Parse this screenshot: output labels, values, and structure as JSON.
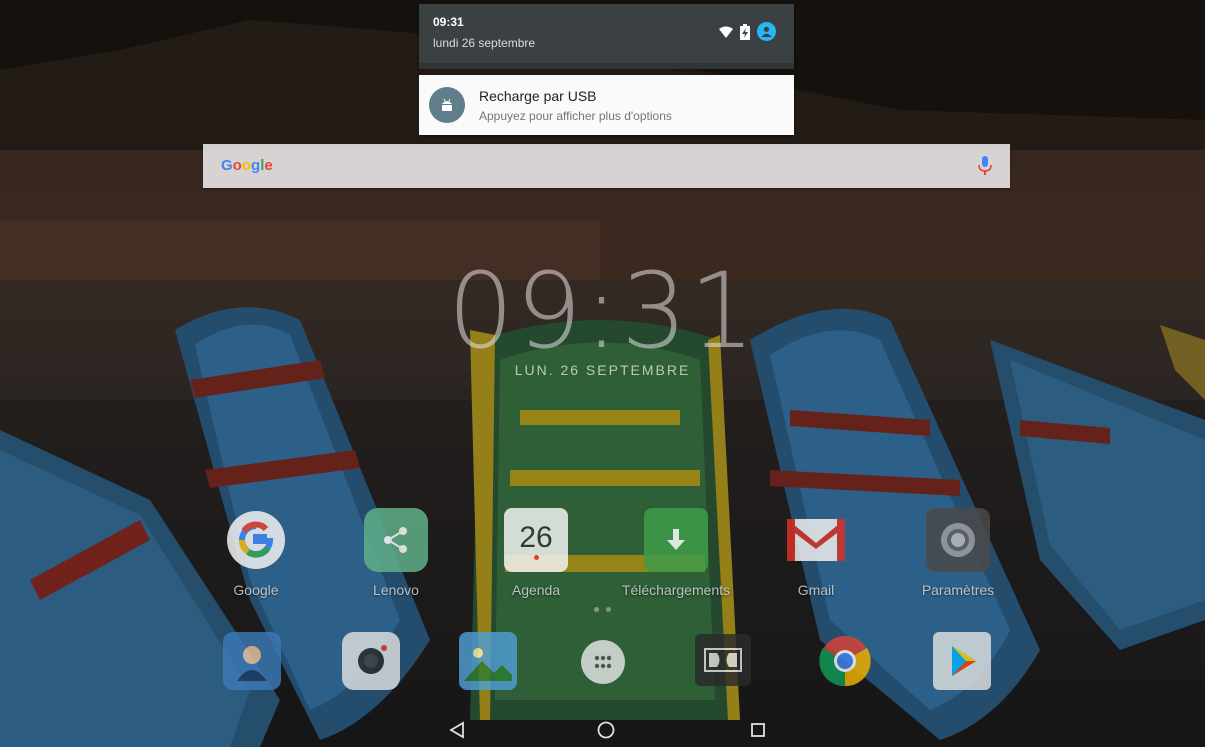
{
  "status": {
    "time": "09:31",
    "date": "lundi 26 septembre"
  },
  "notification": {
    "title": "Recharge par USB",
    "text": "Appuyez pour afficher plus d'options",
    "icon": "android-icon"
  },
  "search": {
    "logo": [
      "G",
      "o",
      "o",
      "g",
      "l",
      "e"
    ]
  },
  "clock": {
    "time": "09:31",
    "date": "LUN. 26 SEPTEMBRE"
  },
  "apps": [
    {
      "label": "Google",
      "icon": "google-icon"
    },
    {
      "label": "Lenovo",
      "icon": "share-icon"
    },
    {
      "label": "Agenda",
      "icon": "calendar-icon",
      "day": "26"
    },
    {
      "label": "Téléchargements",
      "icon": "download-icon"
    },
    {
      "label": "Gmail",
      "icon": "gmail-icon"
    },
    {
      "label": "Paramètres",
      "icon": "settings-icon"
    }
  ],
  "dock": [
    {
      "icon": "contacts-icon"
    },
    {
      "icon": "camera-icon"
    },
    {
      "icon": "gallery-icon"
    },
    {
      "icon": "app-drawer-icon"
    },
    {
      "icon": "dolby-icon"
    },
    {
      "icon": "chrome-icon"
    },
    {
      "icon": "play-store-icon"
    }
  ],
  "nav": [
    "back-icon",
    "home-icon",
    "recents-icon"
  ]
}
